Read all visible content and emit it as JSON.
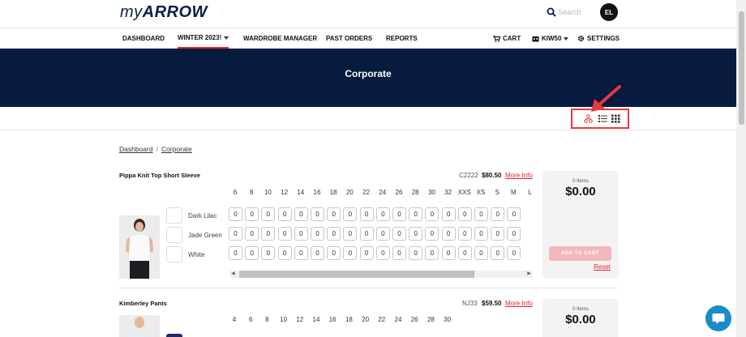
{
  "header": {
    "logo_prefix": "my",
    "logo_main": "ARROW",
    "search_placeholder": "Search",
    "avatar_initials": "EL"
  },
  "nav": {
    "left": [
      "DASHBOARD",
      "WINTER 2023!",
      "WARDROBE MANAGER",
      "PAST ORDERS",
      "REPORTS"
    ],
    "cart": "CART",
    "account": "KIW50",
    "settings": "SETTINGS"
  },
  "banner": {
    "title": "Corporate"
  },
  "breadcrumb": {
    "root": "Dashboard",
    "sep": "/",
    "current": "Corporate"
  },
  "products": [
    {
      "name": "Pippa Knit Top Short Sleeve",
      "code": "C2222",
      "price": "$80.50",
      "more": "More Info",
      "sizes": [
        "6",
        "8",
        "10",
        "12",
        "14",
        "16",
        "18",
        "20",
        "22",
        "24",
        "26",
        "28",
        "30",
        "32",
        "XXS",
        "XS",
        "S",
        "M",
        "L"
      ],
      "colors": [
        "Dark Lilac",
        "Jade Green",
        "White"
      ],
      "qty": "0",
      "cart": {
        "items": "0 Items",
        "total": "$0.00",
        "add": "ADD TO CART",
        "reset": "Reset"
      }
    },
    {
      "name": "Kimberley Pants",
      "code": "NJ33",
      "price": "$59.50",
      "more": "More Info",
      "sizes": [
        "4",
        "6",
        "8",
        "10",
        "12",
        "14",
        "16",
        "18",
        "20",
        "22",
        "24",
        "26",
        "28",
        "30"
      ],
      "colors": [],
      "qty": "0",
      "cart": {
        "items": "0 Items",
        "total": "$0.00"
      }
    }
  ],
  "colors": {
    "navy": "#061b3e",
    "accent_red": "#e5202a",
    "chat_blue": "#1b8bc9"
  }
}
